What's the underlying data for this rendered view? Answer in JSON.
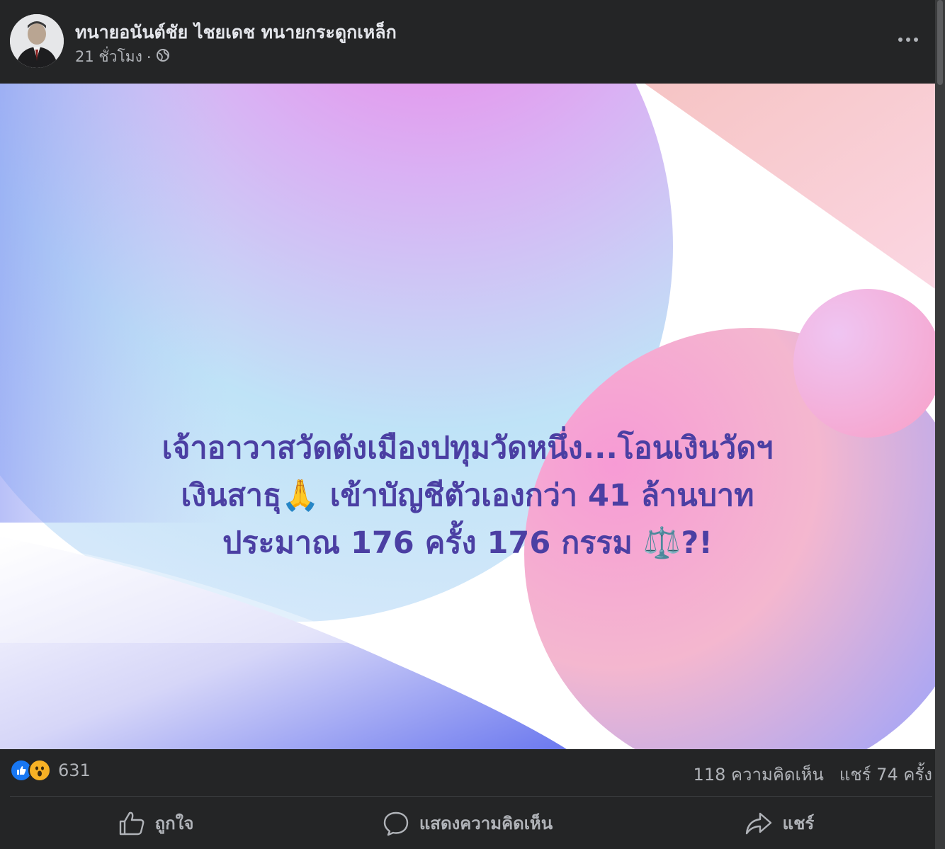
{
  "post": {
    "author": "ทนายอนันต์ชัย ไชยเดช ทนายกระดูกเหล็ก",
    "time": "21 ชั่วโมง",
    "separator": "·",
    "privacy_icon": "globe-icon",
    "more_icon": "more-horizontal-icon"
  },
  "image": {
    "headline_lines": [
      "เจ้าอาวาสวัดดังเมืองปทุมวัดหนึ่ง...โอนเงินวัดฯ",
      "เงินสาธุ🙏 เข้าบัญชีตัวเองกว่า 41 ล้านบาท",
      "ประมาณ 176 ครั้ง 176 กรรม ⚖️?!"
    ],
    "text_color": "#4b3fa3"
  },
  "stats": {
    "reaction_icons": [
      "like-icon",
      "wow-icon"
    ],
    "reaction_count": "631",
    "comments": "118 ความคิดเห็น",
    "shares": "แชร์ 74 ครั้ง"
  },
  "actions": {
    "like": "ถูกใจ",
    "comment": "แสดงความคิดเห็น",
    "share": "แชร์"
  },
  "colors": {
    "background": "#242526",
    "text_primary": "#e4e6eb",
    "text_secondary": "#b0b3b8",
    "like_blue": "#1877f2",
    "wow_yellow": "#f7b125"
  }
}
